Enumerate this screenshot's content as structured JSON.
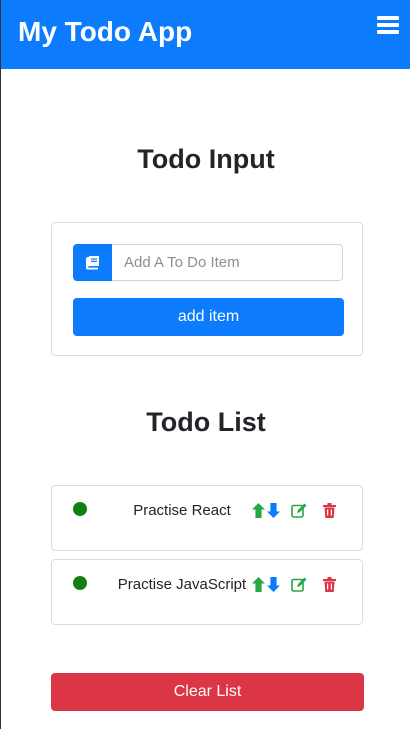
{
  "navbar": {
    "brand": "My Todo App",
    "menu_icon": "hamburger-menu-icon"
  },
  "todo_input": {
    "heading": "Todo Input",
    "field_icon": "book-icon",
    "placeholder": "Add A To Do Item",
    "value": "",
    "add_button_label": "add item"
  },
  "todo_list": {
    "heading": "Todo List",
    "items": [
      {
        "text": "Practise React",
        "status_color": "#118011"
      },
      {
        "text": "Practise JavaScript",
        "status_color": "#118011"
      }
    ],
    "item_action_icons": [
      "arrow-up-icon",
      "arrow-down-icon",
      "edit-icon",
      "trash-icon"
    ],
    "clear_button_label": "Clear List"
  },
  "colors": {
    "primary": "#0d7bfd",
    "danger": "#dc3545",
    "success": "#28a745",
    "status_dot": "#118011"
  }
}
